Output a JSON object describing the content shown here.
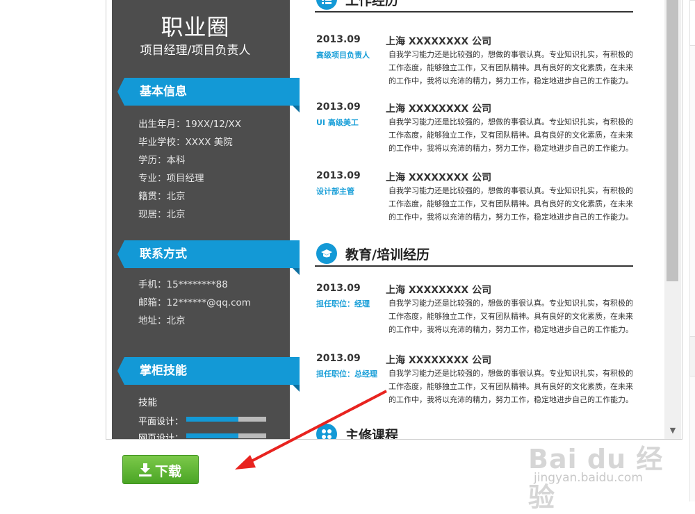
{
  "resume": {
    "name": "职业圈",
    "position": "项目经理/项目负责人",
    "basic_info": {
      "title": "基本信息",
      "items": [
        "出生年月：19XX/12/XX",
        "毕业学校：XXXX 美院",
        "学历：本科",
        "专业：项目经理",
        "籍贯：北京",
        "现居：北京"
      ]
    },
    "contact": {
      "title": "联系方式",
      "items": [
        "手机：15********88",
        "邮箱：12******@qq.com",
        "地址：北京"
      ]
    },
    "skills": {
      "title": "掌柜技能",
      "subtitle": "技能",
      "items": [
        {
          "label": "平面设计：",
          "level": 0.65
        },
        {
          "label": "网页设计：",
          "level": 0.65
        }
      ]
    },
    "work": {
      "title": "工作经历",
      "entries": [
        {
          "date": "2013.09",
          "company": "上海 XXXXXXXX 公司",
          "role": "高级项目负责人",
          "desc": "自我学习能力还是比较强的，想做的事很认真。专业知识扎实，有积极的工作态度，能够独立工作，又有团队精神。具有良好的文化素质，在未来的工作中，我将以充沛的精力，努力工作，稳定地进步自己的工作能力。"
        },
        {
          "date": "2013.09",
          "company": "上海 XXXXXXXX 公司",
          "role": "UI 高级美工",
          "desc": "自我学习能力还是比较强的，想做的事很认真。专业知识扎实，有积极的工作态度，能够独立工作，又有团队精神。具有良好的文化素质，在未来的工作中，我将以充沛的精力，努力工作，稳定地进步自己的工作能力。"
        },
        {
          "date": "2013.09",
          "company": "上海 XXXXXXXX 公司",
          "role": "设计部主管",
          "desc": "自我学习能力还是比较强的，想做的事很认真。专业知识扎实，有积极的工作态度，能够独立工作，又有团队精神。具有良好的文化素质，在未来的工作中，我将以充沛的精力，努力工作，稳定地进步自己的工作能力。"
        }
      ]
    },
    "education": {
      "title": "教育/培训经历",
      "entries": [
        {
          "date": "2013.09",
          "company": "上海 XXXXXXXX 公司",
          "role": "担任职位：经理",
          "desc": "自我学习能力还是比较强的，想做的事很认真。专业知识扎实，有积极的工作态度，能够独立工作，又有团队精神。具有良好的文化素质，在未来的工作中，我将以充沛的精力，努力工作，稳定地进步自己的工作能力。"
        },
        {
          "date": "2013.09",
          "company": "上海 XXXXXXXX 公司",
          "role": "担任职位：总经理",
          "desc": "自我学习能力还是比较强的，想做的事很认真。专业知识扎实，有积极的工作态度，能够独立工作，又有团队精神。具有良好的文化素质，在未来的工作中，我将以充沛的精力，努力工作，稳定地进步自己的工作能力。"
        }
      ]
    },
    "courses": {
      "title": "主修课程"
    }
  },
  "download_button": {
    "label": "下载"
  },
  "watermark": {
    "main": "Bai du 经验",
    "sub": "jingyan.baidu.com"
  },
  "colors": {
    "accent": "#1399d6",
    "sidebar": "#4d4d4d",
    "button": "#5cb531",
    "arrow": "#e8231f"
  }
}
